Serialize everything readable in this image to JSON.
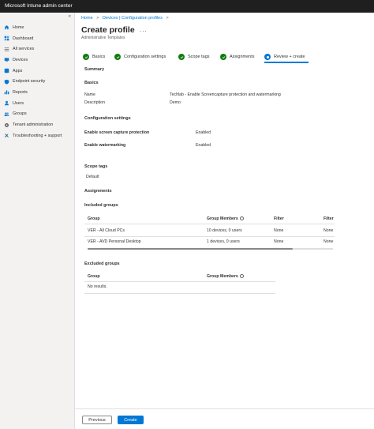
{
  "app": {
    "title": "Microsoft Intune admin center"
  },
  "sidebar": {
    "collapse_glyph": "«",
    "items": [
      {
        "label": "Home",
        "icon": "home-icon"
      },
      {
        "label": "Dashboard",
        "icon": "dashboard-icon"
      },
      {
        "label": "All services",
        "icon": "all-services-icon"
      },
      {
        "label": "Devices",
        "icon": "devices-icon"
      },
      {
        "label": "Apps",
        "icon": "apps-icon"
      },
      {
        "label": "Endpoint security",
        "icon": "endpoint-security-icon"
      },
      {
        "label": "Reports",
        "icon": "reports-icon"
      },
      {
        "label": "Users",
        "icon": "users-icon"
      },
      {
        "label": "Groups",
        "icon": "groups-icon"
      },
      {
        "label": "Tenant administration",
        "icon": "tenant-admin-icon"
      },
      {
        "label": "Troubleshooting + support",
        "icon": "troubleshooting-icon"
      }
    ]
  },
  "breadcrumb": {
    "home": "Home",
    "sep": ">",
    "devices": "Devices | Configuration profiles"
  },
  "page": {
    "title": "Create profile",
    "more": "...",
    "subtitle": "Administrative Templates"
  },
  "steps": [
    {
      "label": "Basics",
      "status": "done"
    },
    {
      "label": "Configuration settings",
      "status": "done"
    },
    {
      "label": "Scope tags",
      "status": "done"
    },
    {
      "label": "Assignments",
      "status": "done"
    },
    {
      "label": "Review + create",
      "status": "active",
      "number": "5"
    }
  ],
  "summary": {
    "heading": "Summary",
    "basics": {
      "heading": "Basics",
      "name_label": "Name",
      "name_value": "Techlab - Enable Screencapture protection and watermarking",
      "description_label": "Description",
      "description_value": "Demo"
    },
    "config": {
      "heading": "Configuration settings",
      "rows": [
        {
          "label": "Enable screen capture protection",
          "value": "Enabled"
        },
        {
          "label": "Enable watermarking",
          "value": "Enabled"
        }
      ]
    },
    "scope": {
      "heading": "Scope tags",
      "value": "Default"
    },
    "assignments": {
      "heading": "Assignments",
      "included": {
        "heading": "Included groups",
        "columns": [
          "Group",
          "Group Members",
          "Filter",
          "Filter"
        ],
        "rows": [
          {
            "group": "VER - All Cloud PCs",
            "members": "10 devices, 0 users",
            "filter": "None",
            "filter2": "None"
          },
          {
            "group": "VER - AVD Personal Desktop",
            "members": "1 devices, 0 users",
            "filter": "None",
            "filter2": "None"
          }
        ]
      },
      "excluded": {
        "heading": "Excluded groups",
        "columns": [
          "Group",
          "Group Members"
        ],
        "empty": "No results."
      }
    }
  },
  "footer": {
    "previous": "Previous",
    "create": "Create"
  },
  "colors": {
    "accent": "#0078d4",
    "success": "#107c10",
    "topbar": "#1f1f1f"
  }
}
